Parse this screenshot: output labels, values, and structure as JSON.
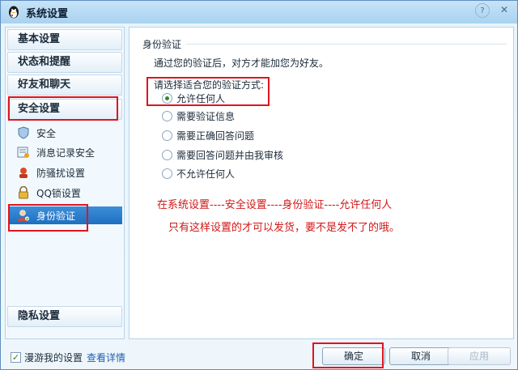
{
  "window": {
    "title": "系统设置",
    "help_icon": "help-icon",
    "close_icon": "close-icon"
  },
  "sidebar": {
    "categories": [
      {
        "label": "基本设置"
      },
      {
        "label": "状态和提醒"
      },
      {
        "label": "好友和聊天"
      },
      {
        "label": "安全设置"
      },
      {
        "label": "隐私设置"
      }
    ],
    "security_items": [
      {
        "label": "安全",
        "icon": "shield-icon"
      },
      {
        "label": "消息记录安全",
        "icon": "message-log-icon"
      },
      {
        "label": "防骚扰设置",
        "icon": "anti-harassment-icon"
      },
      {
        "label": "QQ锁设置",
        "icon": "lock-icon"
      },
      {
        "label": "身份验证",
        "icon": "user-verify-icon"
      }
    ]
  },
  "main": {
    "section_title": "身份验证",
    "description": "通过您的验证后，对方才能加您为好友。",
    "prompt": "请选择适合您的验证方式:",
    "options": [
      {
        "label": "允许任何人",
        "checked": true
      },
      {
        "label": "需要验证信息",
        "checked": false
      },
      {
        "label": "需要正确回答问题",
        "checked": false
      },
      {
        "label": "需要回答问题并由我审核",
        "checked": false
      },
      {
        "label": "不允许任何人",
        "checked": false
      }
    ],
    "annotation_line1": "在系统设置----安全设置----身份验证----允许任何人",
    "annotation_line2": "只有这样设置的才可以发货，要不是发不了的哦。",
    "annotation_color": "#d11818"
  },
  "footer": {
    "roam_checkbox_checked": true,
    "roam_label": "漫游我的设置",
    "details_link": "查看详情",
    "ok_label": "确定",
    "cancel_label": "取消",
    "apply_label": "应用"
  },
  "colors": {
    "highlight": "#e0141e",
    "selected_item": "#2a7dcc",
    "link": "#1d5fb3"
  }
}
